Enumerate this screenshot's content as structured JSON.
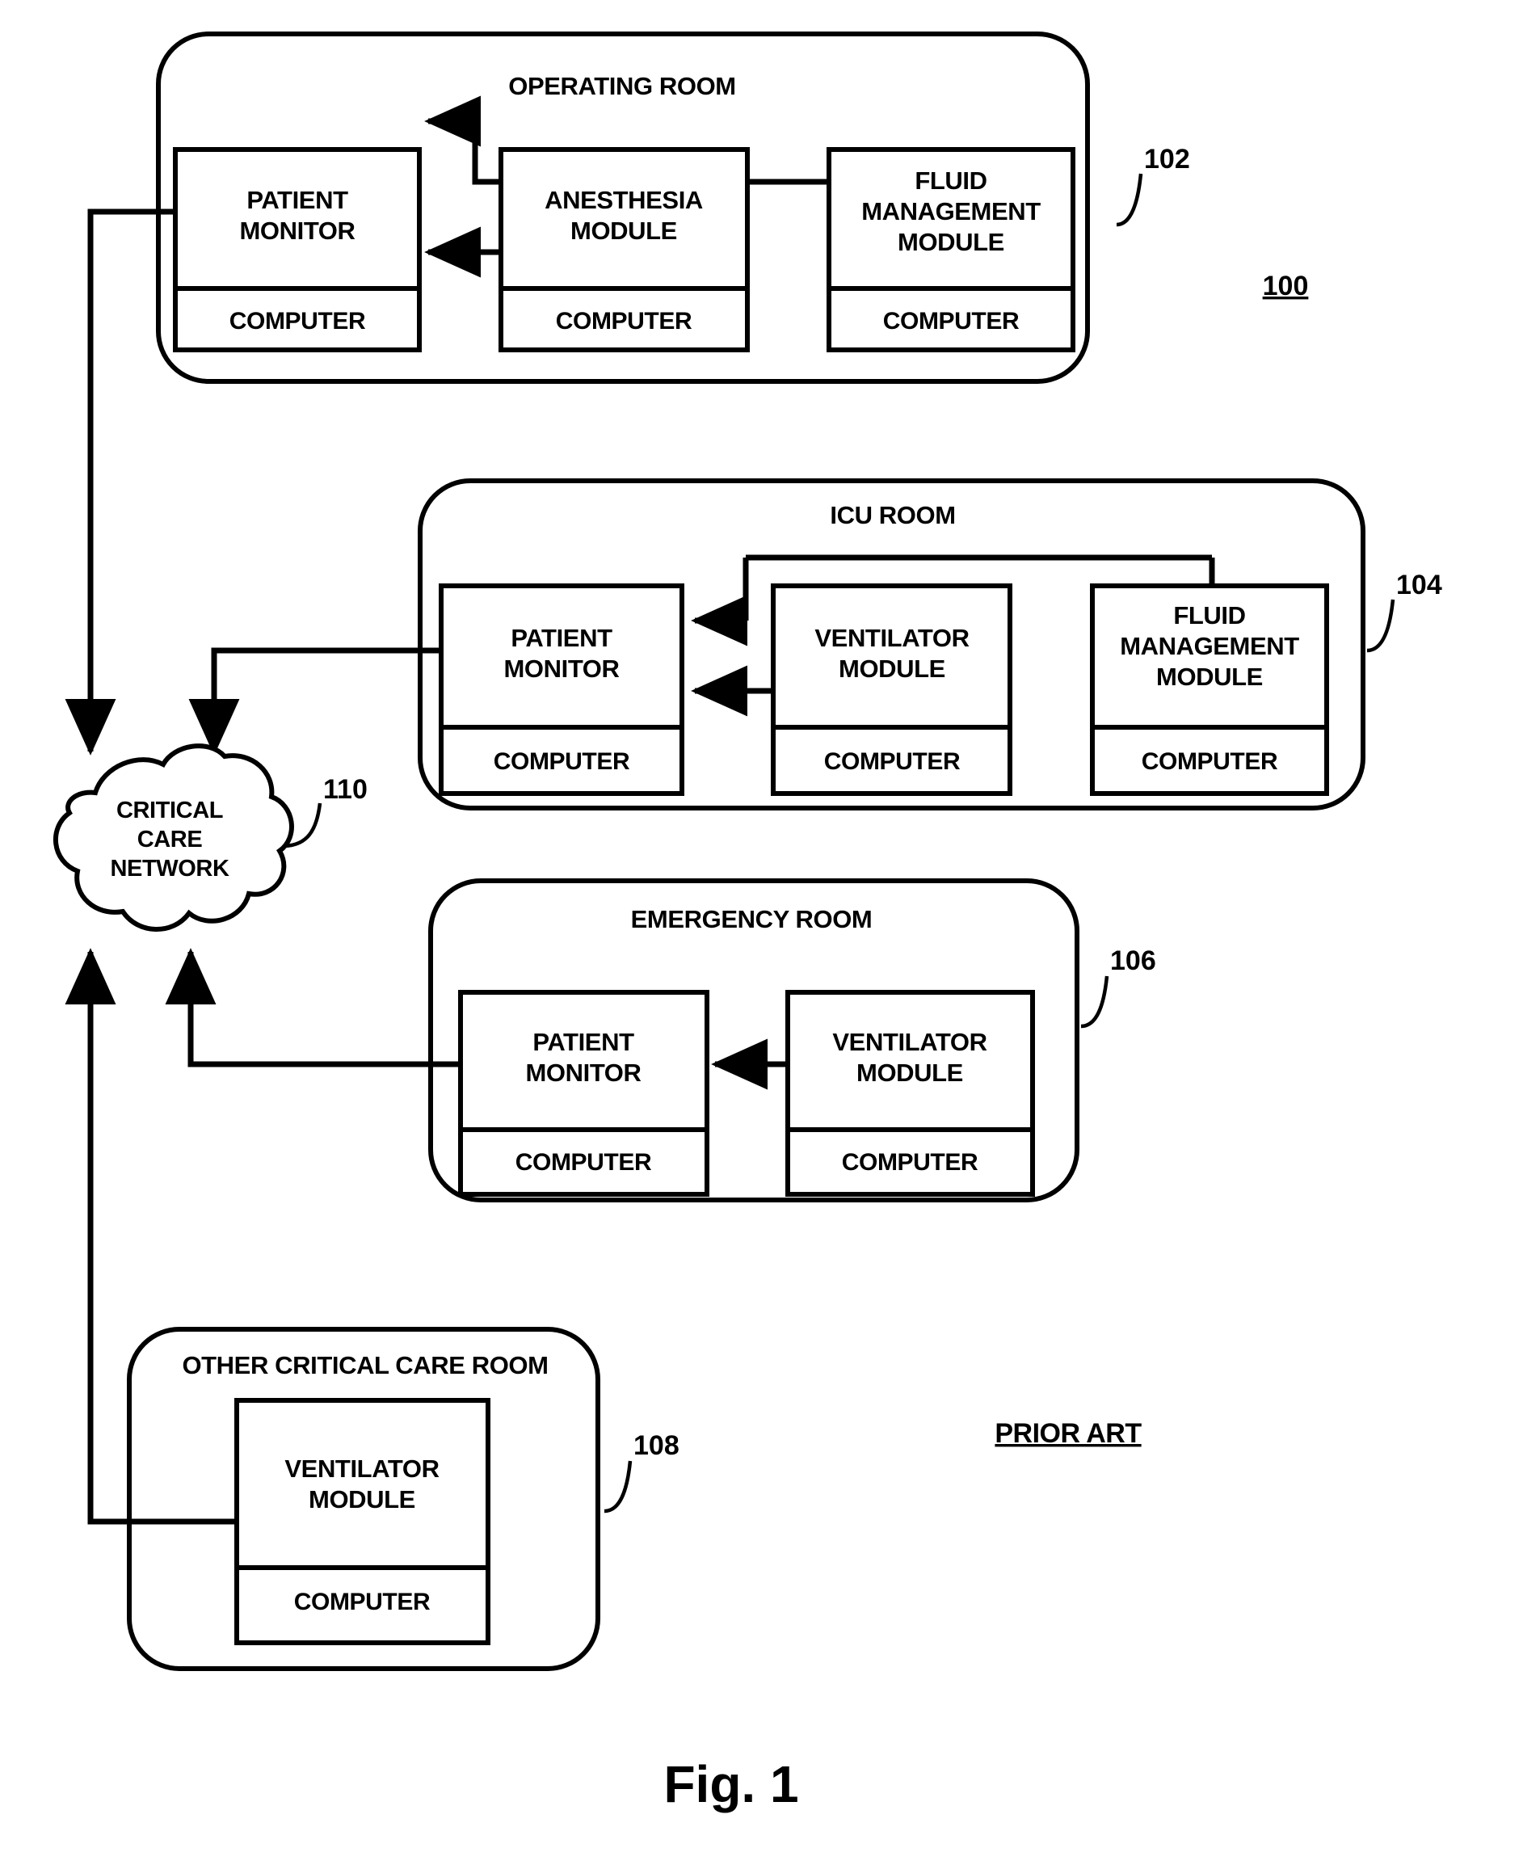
{
  "figure": {
    "label": "Fig.  1",
    "prior_art": "PRIOR ART",
    "system_ref": "100"
  },
  "network": {
    "name": "network-cloud",
    "line1": "CRITICAL",
    "line2": "CARE",
    "line3": "NETWORK",
    "ref": "110"
  },
  "rooms": [
    {
      "id": "operating-room",
      "title": "OPERATING ROOM",
      "ref": "102",
      "devices": [
        {
          "id": "patient-monitor",
          "line1": "PATIENT",
          "line2": "MONITOR",
          "sub": "COMPUTER"
        },
        {
          "id": "anesthesia-module",
          "line1": "ANESTHESIA",
          "line2": "MODULE",
          "sub": "COMPUTER"
        },
        {
          "id": "fluid-management-module",
          "line1": "FLUID",
          "line2": "MANAGEMENT",
          "line3": "MODULE",
          "sub": "COMPUTER"
        }
      ]
    },
    {
      "id": "icu-room",
      "title": "ICU ROOM",
      "ref": "104",
      "devices": [
        {
          "id": "patient-monitor",
          "line1": "PATIENT",
          "line2": "MONITOR",
          "sub": "COMPUTER"
        },
        {
          "id": "ventilator-module",
          "line1": "VENTILATOR",
          "line2": "MODULE",
          "sub": "COMPUTER"
        },
        {
          "id": "fluid-management-module",
          "line1": "FLUID",
          "line2": "MANAGEMENT",
          "line3": "MODULE",
          "sub": "COMPUTER"
        }
      ]
    },
    {
      "id": "emergency-room",
      "title": "EMERGENCY ROOM",
      "ref": "106",
      "devices": [
        {
          "id": "patient-monitor",
          "line1": "PATIENT",
          "line2": "MONITOR",
          "sub": "COMPUTER"
        },
        {
          "id": "ventilator-module",
          "line1": "VENTILATOR",
          "line2": "MODULE",
          "sub": "COMPUTER"
        }
      ]
    },
    {
      "id": "other-critical-care-room",
      "title": "OTHER CRITICAL CARE ROOM",
      "ref": "108",
      "devices": [
        {
          "id": "ventilator-module",
          "line1": "VENTILATOR",
          "line2": "MODULE",
          "sub": "COMPUTER"
        }
      ]
    }
  ],
  "colors": {
    "ink": "#000000",
    "paper": "#ffffff"
  }
}
